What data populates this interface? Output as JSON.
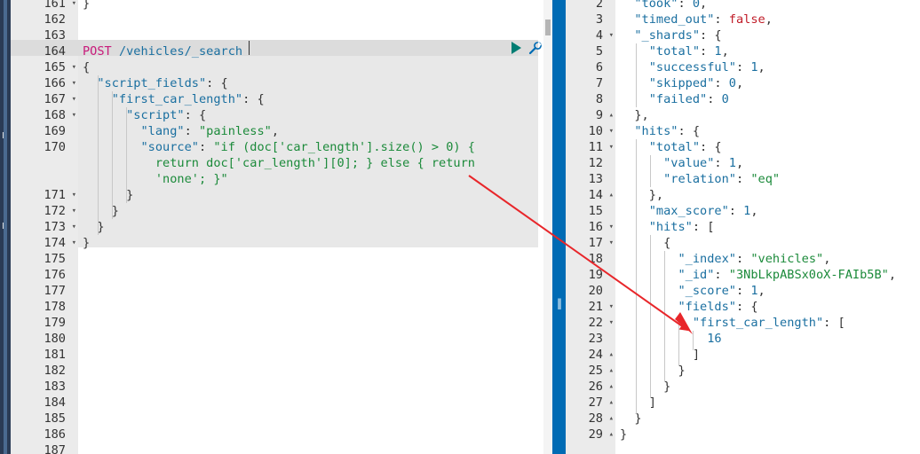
{
  "left": {
    "method": "POST",
    "url": "/vehicles/_search",
    "lines": [
      {
        "n": "161",
        "fold": "▾",
        "text": [
          [
            "p",
            "}"
          ]
        ]
      },
      {
        "n": "162",
        "fold": "",
        "text": []
      },
      {
        "n": "163",
        "fold": "",
        "text": []
      },
      {
        "n": "164",
        "fold": "",
        "text": [
          [
            "m",
            "POST"
          ],
          [
            "p",
            " "
          ],
          [
            "u",
            "/vehicles/_search"
          ]
        ]
      },
      {
        "n": "165",
        "fold": "▾",
        "text": [
          [
            "p",
            "{"
          ]
        ]
      },
      {
        "n": "166",
        "fold": "▾",
        "text": [
          [
            "p",
            "  "
          ],
          [
            "k",
            "\"script_fields\""
          ],
          [
            "p",
            ": {"
          ]
        ]
      },
      {
        "n": "167",
        "fold": "▾",
        "text": [
          [
            "p",
            "    "
          ],
          [
            "k",
            "\"first_car_length\""
          ],
          [
            "p",
            ": {"
          ]
        ]
      },
      {
        "n": "168",
        "fold": "▾",
        "text": [
          [
            "p",
            "      "
          ],
          [
            "k",
            "\"script\""
          ],
          [
            "p",
            ": {"
          ]
        ]
      },
      {
        "n": "169",
        "fold": "",
        "text": [
          [
            "p",
            "        "
          ],
          [
            "k",
            "\"lang\""
          ],
          [
            "p",
            ": "
          ],
          [
            "s",
            "\"painless\""
          ],
          [
            "p",
            ","
          ]
        ]
      },
      {
        "n": "170",
        "fold": "",
        "text": [
          [
            "p",
            "        "
          ],
          [
            "k",
            "\"source\""
          ],
          [
            "p",
            ": "
          ],
          [
            "s",
            "\"if (doc['car_length'].size() > 0) {"
          ]
        ]
      },
      {
        "n": "",
        "fold": "",
        "text": [
          [
            "s",
            "          return doc['car_length'][0]; } else { return"
          ]
        ]
      },
      {
        "n": "",
        "fold": "",
        "text": [
          [
            "s",
            "          'none'; }\""
          ]
        ]
      },
      {
        "n": "171",
        "fold": "▾",
        "text": [
          [
            "p",
            "      }"
          ]
        ]
      },
      {
        "n": "172",
        "fold": "▾",
        "text": [
          [
            "p",
            "    }"
          ]
        ]
      },
      {
        "n": "173",
        "fold": "▾",
        "text": [
          [
            "p",
            "  }"
          ]
        ]
      },
      {
        "n": "174",
        "fold": "▾",
        "text": [
          [
            "p",
            "}"
          ]
        ]
      },
      {
        "n": "175",
        "fold": "",
        "text": []
      },
      {
        "n": "176",
        "fold": "",
        "text": []
      },
      {
        "n": "177",
        "fold": "",
        "text": []
      },
      {
        "n": "178",
        "fold": "",
        "text": []
      },
      {
        "n": "179",
        "fold": "",
        "text": []
      },
      {
        "n": "180",
        "fold": "",
        "text": []
      },
      {
        "n": "181",
        "fold": "",
        "text": []
      },
      {
        "n": "182",
        "fold": "",
        "text": []
      },
      {
        "n": "183",
        "fold": "",
        "text": []
      },
      {
        "n": "184",
        "fold": "",
        "text": []
      },
      {
        "n": "185",
        "fold": "",
        "text": []
      },
      {
        "n": "186",
        "fold": "",
        "text": []
      },
      {
        "n": "187",
        "fold": "",
        "text": []
      }
    ]
  },
  "right": {
    "lines": [
      {
        "n": "2",
        "fold": "",
        "text": [
          [
            "p",
            "  "
          ],
          [
            "k",
            "\"took\""
          ],
          [
            "p",
            ": "
          ],
          [
            "n",
            "0"
          ],
          [
            "p",
            ","
          ]
        ]
      },
      {
        "n": "3",
        "fold": "",
        "text": [
          [
            "p",
            "  "
          ],
          [
            "k",
            "\"timed_out\""
          ],
          [
            "p",
            ": "
          ],
          [
            "b",
            "false"
          ],
          [
            "p",
            ","
          ]
        ]
      },
      {
        "n": "4",
        "fold": "▾",
        "text": [
          [
            "p",
            "  "
          ],
          [
            "k",
            "\"_shards\""
          ],
          [
            "p",
            ": {"
          ]
        ]
      },
      {
        "n": "5",
        "fold": "",
        "text": [
          [
            "p",
            "    "
          ],
          [
            "k",
            "\"total\""
          ],
          [
            "p",
            ": "
          ],
          [
            "n",
            "1"
          ],
          [
            "p",
            ","
          ]
        ]
      },
      {
        "n": "6",
        "fold": "",
        "text": [
          [
            "p",
            "    "
          ],
          [
            "k",
            "\"successful\""
          ],
          [
            "p",
            ": "
          ],
          [
            "n",
            "1"
          ],
          [
            "p",
            ","
          ]
        ]
      },
      {
        "n": "7",
        "fold": "",
        "text": [
          [
            "p",
            "    "
          ],
          [
            "k",
            "\"skipped\""
          ],
          [
            "p",
            ": "
          ],
          [
            "n",
            "0"
          ],
          [
            "p",
            ","
          ]
        ]
      },
      {
        "n": "8",
        "fold": "",
        "text": [
          [
            "p",
            "    "
          ],
          [
            "k",
            "\"failed\""
          ],
          [
            "p",
            ": "
          ],
          [
            "n",
            "0"
          ]
        ]
      },
      {
        "n": "9",
        "fold": "▴",
        "text": [
          [
            "p",
            "  },"
          ]
        ]
      },
      {
        "n": "10",
        "fold": "▾",
        "text": [
          [
            "p",
            "  "
          ],
          [
            "k",
            "\"hits\""
          ],
          [
            "p",
            ": {"
          ]
        ]
      },
      {
        "n": "11",
        "fold": "▾",
        "text": [
          [
            "p",
            "    "
          ],
          [
            "k",
            "\"total\""
          ],
          [
            "p",
            ": {"
          ]
        ]
      },
      {
        "n": "12",
        "fold": "",
        "text": [
          [
            "p",
            "      "
          ],
          [
            "k",
            "\"value\""
          ],
          [
            "p",
            ": "
          ],
          [
            "n",
            "1"
          ],
          [
            "p",
            ","
          ]
        ]
      },
      {
        "n": "13",
        "fold": "",
        "text": [
          [
            "p",
            "      "
          ],
          [
            "k",
            "\"relation\""
          ],
          [
            "p",
            ": "
          ],
          [
            "s",
            "\"eq\""
          ]
        ]
      },
      {
        "n": "14",
        "fold": "▴",
        "text": [
          [
            "p",
            "    },"
          ]
        ]
      },
      {
        "n": "15",
        "fold": "",
        "text": [
          [
            "p",
            "    "
          ],
          [
            "k",
            "\"max_score\""
          ],
          [
            "p",
            ": "
          ],
          [
            "n",
            "1"
          ],
          [
            "p",
            ","
          ]
        ]
      },
      {
        "n": "16",
        "fold": "▾",
        "text": [
          [
            "p",
            "    "
          ],
          [
            "k",
            "\"hits\""
          ],
          [
            "p",
            ": ["
          ]
        ]
      },
      {
        "n": "17",
        "fold": "▾",
        "text": [
          [
            "p",
            "      {"
          ]
        ]
      },
      {
        "n": "18",
        "fold": "",
        "text": [
          [
            "p",
            "        "
          ],
          [
            "k",
            "\"_index\""
          ],
          [
            "p",
            ": "
          ],
          [
            "s",
            "\"vehicles\""
          ],
          [
            "p",
            ","
          ]
        ]
      },
      {
        "n": "19",
        "fold": "",
        "text": [
          [
            "p",
            "        "
          ],
          [
            "k",
            "\"_id\""
          ],
          [
            "p",
            ": "
          ],
          [
            "s",
            "\"3NbLkpABSx0oX-FAIb5B\""
          ],
          [
            "p",
            ","
          ]
        ]
      },
      {
        "n": "20",
        "fold": "",
        "text": [
          [
            "p",
            "        "
          ],
          [
            "k",
            "\"_score\""
          ],
          [
            "p",
            ": "
          ],
          [
            "n",
            "1"
          ],
          [
            "p",
            ","
          ]
        ]
      },
      {
        "n": "21",
        "fold": "▾",
        "text": [
          [
            "p",
            "        "
          ],
          [
            "k",
            "\"fields\""
          ],
          [
            "p",
            ": {"
          ]
        ]
      },
      {
        "n": "22",
        "fold": "▾",
        "text": [
          [
            "p",
            "          "
          ],
          [
            "k",
            "\"first_car_length\""
          ],
          [
            "p",
            ": ["
          ]
        ]
      },
      {
        "n": "23",
        "fold": "",
        "text": [
          [
            "p",
            "            "
          ],
          [
            "n",
            "16"
          ]
        ]
      },
      {
        "n": "24",
        "fold": "▴",
        "text": [
          [
            "p",
            "          ]"
          ]
        ]
      },
      {
        "n": "25",
        "fold": "▴",
        "text": [
          [
            "p",
            "        }"
          ]
        ]
      },
      {
        "n": "26",
        "fold": "▴",
        "text": [
          [
            "p",
            "      }"
          ]
        ]
      },
      {
        "n": "27",
        "fold": "▴",
        "text": [
          [
            "p",
            "    ]"
          ]
        ]
      },
      {
        "n": "28",
        "fold": "▴",
        "text": [
          [
            "p",
            "  }"
          ]
        ]
      },
      {
        "n": "29",
        "fold": "▴",
        "text": [
          [
            "p",
            "}"
          ]
        ]
      }
    ]
  },
  "edge_labels": [
    "F",
    "E"
  ],
  "colors": {
    "divider": "#006bb4",
    "run": "#017d73",
    "arrow": "#e8262a"
  },
  "icons": {
    "run": "play-icon",
    "settings": "wrench-icon",
    "divider_grip": "drag-handle-icon"
  }
}
